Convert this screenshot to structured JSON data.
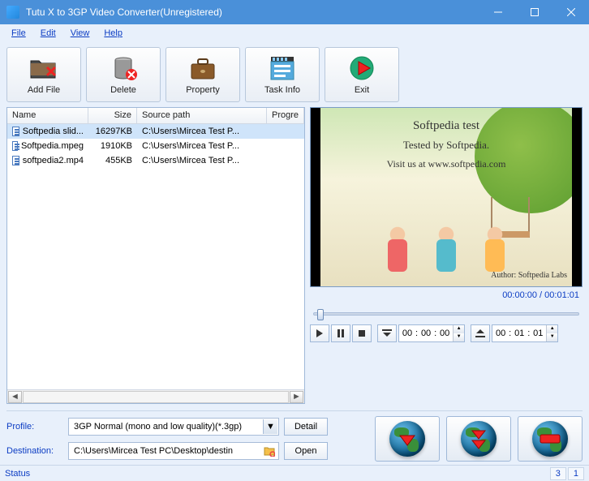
{
  "window": {
    "title": "Tutu X to 3GP Video Converter(Unregistered)"
  },
  "menu": {
    "file": "File",
    "edit": "Edit",
    "view": "View",
    "help": "Help"
  },
  "toolbar": {
    "add_file": "Add File",
    "delete": "Delete",
    "property": "Property",
    "task_info": "Task Info",
    "exit": "Exit"
  },
  "columns": {
    "name": "Name",
    "size": "Size",
    "path": "Source path",
    "progress": "Progre"
  },
  "files": [
    {
      "name": "Softpedia slid...",
      "size": "16297KB",
      "path": "C:\\Users\\Mircea Test P...",
      "selected": true
    },
    {
      "name": "Softpedia.mpeg",
      "size": "1910KB",
      "path": "C:\\Users\\Mircea Test P...",
      "selected": false
    },
    {
      "name": "softpedia2.mp4",
      "size": "455KB",
      "path": "C:\\Users\\Mircea Test P...",
      "selected": false
    }
  ],
  "preview": {
    "line1": "Softpedia test",
    "line2": "Tested by Softpedia.",
    "line3": "Visit us at www.softpedia.com",
    "author": "Author: Softpedia Labs"
  },
  "playback": {
    "time_display": "00:00:00 / 00:01:01",
    "start_time": {
      "h": "00",
      "m": "00",
      "s": "00"
    },
    "end_time": {
      "h": "00",
      "m": "01",
      "s": "01"
    }
  },
  "bottom": {
    "profile_label": "Profile:",
    "profile_value": "3GP Normal (mono and low quality)(*.3gp)",
    "detail_btn": "Detail",
    "destination_label": "Destination:",
    "destination_value": "C:\\Users\\Mircea Test PC\\Desktop\\destin",
    "open_btn": "Open"
  },
  "status": {
    "label": "Status",
    "counter1": "3",
    "counter2": "1"
  }
}
